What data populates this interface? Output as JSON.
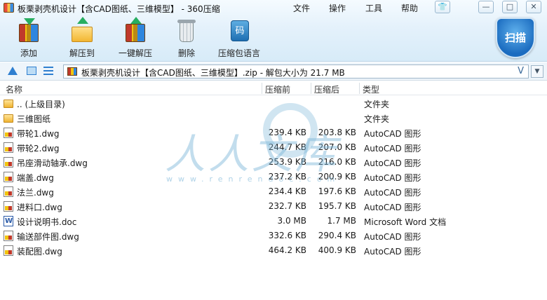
{
  "window": {
    "title": "板栗剥壳机设计【含CAD图纸、三维模型】 - 360压缩",
    "menu": [
      "文件",
      "操作",
      "工具",
      "帮助"
    ],
    "controls": {
      "skin": "👕",
      "minimize": "—",
      "restore": "□",
      "close": "✕"
    }
  },
  "toolbar": {
    "items": [
      {
        "label": "添加",
        "icon": "add-archive-icon"
      },
      {
        "label": "解压到",
        "icon": "extract-to-icon"
      },
      {
        "label": "一键解压",
        "icon": "one-click-extract-icon"
      },
      {
        "label": "删除",
        "icon": "trash-icon"
      },
      {
        "label": "压缩包语言",
        "icon": "archive-language-icon"
      }
    ],
    "lang_glyph": "码",
    "scan_label": "扫描"
  },
  "addressbar": {
    "path": "板栗剥壳机设计【含CAD图纸、三维模型】.zip - 解包大小为 21.7 MB",
    "v_glyph": "V",
    "drop_glyph": "▼"
  },
  "columns": {
    "name": "名称",
    "size": "压缩前",
    "packed": "压缩后",
    "type": "类型"
  },
  "files": [
    {
      "name": ".. (上级目录)",
      "size": "",
      "packed": "",
      "type": "文件夹",
      "icon": "folder"
    },
    {
      "name": "三维图纸",
      "size": "",
      "packed": "",
      "type": "文件夹",
      "icon": "folder"
    },
    {
      "name": "带轮1.dwg",
      "size": "239.4 KB",
      "packed": "203.8 KB",
      "type": "AutoCAD 图形",
      "icon": "dwg"
    },
    {
      "name": "带轮2.dwg",
      "size": "244.7 KB",
      "packed": "207.0 KB",
      "type": "AutoCAD 图形",
      "icon": "dwg"
    },
    {
      "name": "吊座滑动轴承.dwg",
      "size": "253.9 KB",
      "packed": "216.0 KB",
      "type": "AutoCAD 图形",
      "icon": "dwg"
    },
    {
      "name": "端盖.dwg",
      "size": "237.2 KB",
      "packed": "200.9 KB",
      "type": "AutoCAD 图形",
      "icon": "dwg"
    },
    {
      "name": "法兰.dwg",
      "size": "234.4 KB",
      "packed": "197.6 KB",
      "type": "AutoCAD 图形",
      "icon": "dwg"
    },
    {
      "name": "进料口.dwg",
      "size": "232.7 KB",
      "packed": "195.7 KB",
      "type": "AutoCAD 图形",
      "icon": "dwg"
    },
    {
      "name": "设计说明书.doc",
      "size": "3.0 MB",
      "packed": "1.7 MB",
      "type": "Microsoft Word 文档",
      "icon": "doc"
    },
    {
      "name": "输送部件图.dwg",
      "size": "332.6 KB",
      "packed": "290.4 KB",
      "type": "AutoCAD 图形",
      "icon": "dwg"
    },
    {
      "name": "装配图.dwg",
      "size": "464.2 KB",
      "packed": "400.9 KB",
      "type": "AutoCAD 图形",
      "icon": "dwg"
    }
  ],
  "watermark": {
    "text": "人人文库",
    "url": "www.renrendoc.com"
  }
}
